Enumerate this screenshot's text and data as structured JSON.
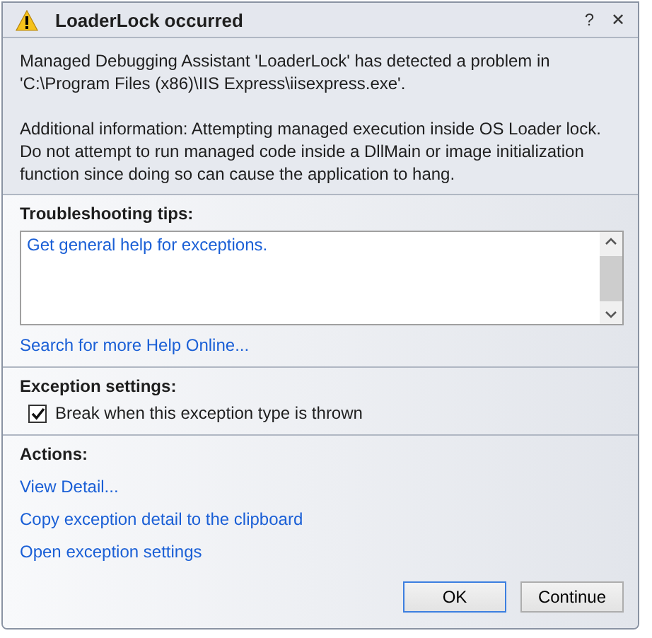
{
  "window": {
    "title": "LoaderLock occurred",
    "help": "?",
    "close": "✕"
  },
  "message": {
    "paragraphs": [
      "Managed Debugging Assistant 'LoaderLock' has detected a problem in 'C:\\Program Files (x86)\\IIS Express\\iisexpress.exe'.",
      "Additional information: Attempting managed execution inside OS Loader lock. Do not attempt to run managed code inside a DllMain or image initialization function since doing so can cause the application to hang."
    ]
  },
  "troubleshooting": {
    "heading": "Troubleshooting tips:",
    "tips": [
      "Get general help for exceptions."
    ],
    "search_link": "Search for more Help Online..."
  },
  "exception_settings": {
    "heading": "Exception settings:",
    "checkbox": {
      "label": "Break when this exception type is thrown",
      "checked": true
    }
  },
  "actions": {
    "heading": "Actions:",
    "links": [
      "View Detail...",
      "Copy exception detail to the clipboard",
      "Open exception settings"
    ]
  },
  "buttons": [
    {
      "label": "OK",
      "default": true
    },
    {
      "label": "Continue",
      "default": false
    }
  ]
}
